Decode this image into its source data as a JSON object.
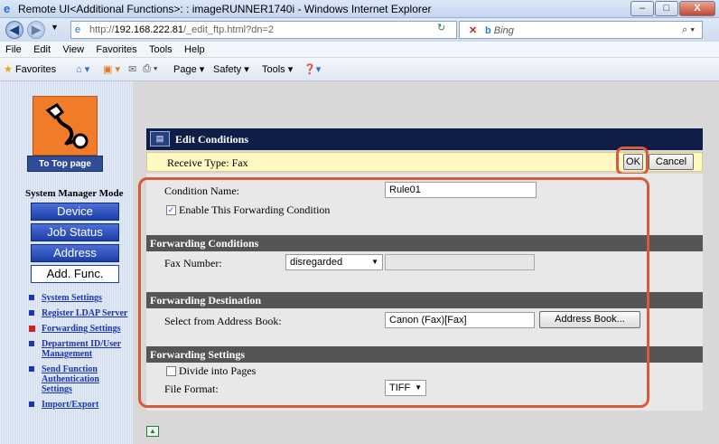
{
  "window": {
    "title": "Remote UI<Additional Functions>: : imageRUNNER1740i - Windows Internet Explorer",
    "minimize": "–",
    "maximize": "□",
    "close": "X"
  },
  "addressbar": {
    "url_prefix": "http://",
    "url_host": "192.168.222.81",
    "url_path": "/_edit_ftp.html?dn=2",
    "search_placeholder": "Bing"
  },
  "menubar": [
    "File",
    "Edit",
    "View",
    "Favorites",
    "Tools",
    "Help"
  ],
  "favbar": {
    "favorites": "Favorites",
    "page": "Page ▾",
    "safety": "Safety ▾",
    "tools": "Tools ▾"
  },
  "sidebar": {
    "to_top": "To Top page",
    "mode_title": "System Manager Mode",
    "buttons": [
      "Device",
      "Job Status",
      "Address",
      "Add. Func."
    ],
    "links": [
      "System Settings",
      "Register LDAP Server",
      "Forwarding Settings",
      "Department ID/User Management",
      "Send Function Authentication Settings",
      "Import/Export"
    ]
  },
  "edit": {
    "title": "Edit Conditions",
    "receive_type": "Receive Type: Fax",
    "ok": "OK",
    "cancel": "Cancel",
    "condition_name_label": "Condition Name:",
    "condition_name_value": "Rule01",
    "enable_label": "Enable This Forwarding Condition",
    "section_conditions": "Forwarding Conditions",
    "fax_number_label": "Fax Number:",
    "fax_number_select": "disregarded",
    "section_destination": "Forwarding Destination",
    "address_book_label": "Select from Address Book:",
    "address_book_value": "Canon (Fax)[Fax]",
    "address_book_button": "Address Book...",
    "section_settings": "Forwarding Settings",
    "divide_label": "Divide into Pages",
    "file_format_label": "File Format:",
    "file_format_value": "TIFF"
  }
}
